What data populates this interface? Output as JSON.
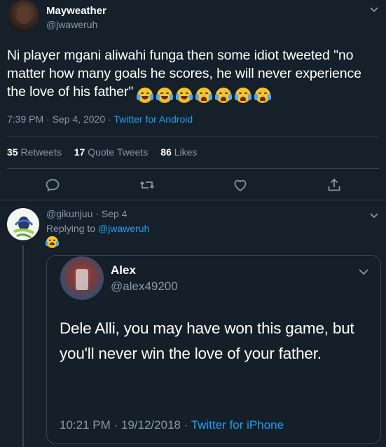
{
  "main_tweet": {
    "display_name": "Mayweather",
    "handle": "@jwaweruh",
    "text": "Ni player mgani aliwahi funga then some idiot tweeted \"no matter how many goals he scores, he will never experience the love of his father\"",
    "emojis": [
      "face-with-tears-of-joy",
      "face-with-tears-of-joy",
      "face-with-tears-of-joy",
      "loudly-crying-face",
      "loudly-crying-face",
      "loudly-crying-face",
      "loudly-crying-face"
    ],
    "time": "7:39 PM",
    "date": "Sep 4, 2020",
    "source": "Twitter for Android",
    "stats": {
      "retweets_count": "35",
      "retweets_label": "Retweets",
      "quotes_count": "17",
      "quotes_label": "Quote Tweets",
      "likes_count": "86",
      "likes_label": "Likes"
    }
  },
  "actions": [
    "reply-icon",
    "retweet-icon",
    "like-icon",
    "share-icon"
  ],
  "reply": {
    "handle": "@gikunjuu",
    "date": "Sep 4",
    "replying_prefix": "Replying to",
    "replying_to": "@jwaweruh",
    "emoji": "loudly-crying-face",
    "quoted": {
      "display_name": "Alex",
      "handle": "@alex49200",
      "text": "Dele Alli, you may have won this game, but you'll never win the love of your father.",
      "time": "10:21 PM",
      "date": "19/12/2018",
      "source": "Twitter for iPhone"
    }
  },
  "colors": {
    "background": "#15202b",
    "text_primary": "#ffffff",
    "text_secondary": "#8899a6",
    "link": "#1da1f2",
    "border": "#38444d"
  }
}
